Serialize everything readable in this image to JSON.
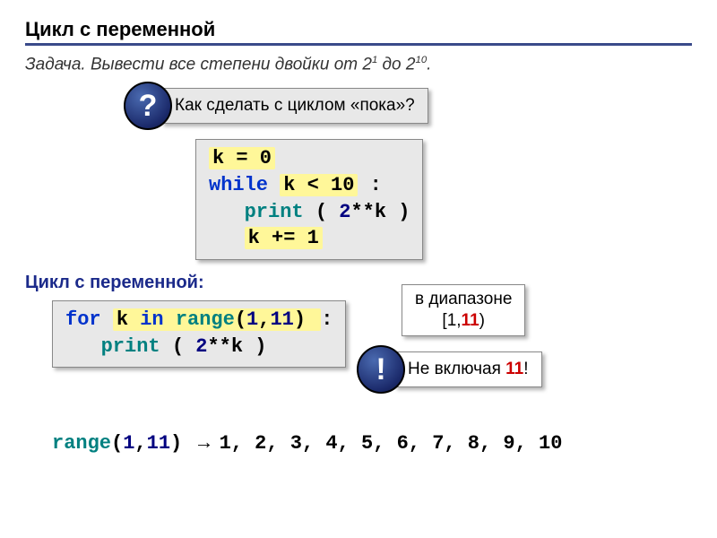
{
  "title": "Цикл с переменной",
  "task_prefix": "Задача.",
  "task_body_a": " Вывести все степени двойки от 2",
  "task_exp1": "1",
  "task_mid": " до 2",
  "task_exp2": "10",
  "task_end": ".",
  "q_badge": "?",
  "q_text": " Как сделать с циклом «пока»?",
  "code1": {
    "l1a": "k = 0",
    "l2a": "while",
    "l2b": "k < 10",
    "l2c": ":",
    "l3a": "print",
    "l3b": "(",
    "l3c": "2",
    "l3d": "**k",
    "l3e": ")",
    "l4a": "k += 1"
  },
  "subtitle": "Цикл с переменной:",
  "code2": {
    "l1a": "for",
    "l1b": "k",
    "l1c": "in",
    "l1d": "range",
    "l1e": "(",
    "l1f": "1",
    "l1g": ",",
    "l1h": "11",
    "l1i": ")",
    "l1j": ":",
    "l2a": "print",
    "l2b": "(",
    "l2c": "2",
    "l2d": "**k",
    "l2e": ")"
  },
  "range_callout_a": "в диапазоне",
  "range_callout_b": "[1,",
  "range_callout_c": "11",
  "range_callout_d": ")",
  "excl_badge": "!",
  "excl_text_a": " Не включая ",
  "excl_text_b": "11",
  "excl_text_c": "!",
  "rangeline": {
    "a": "range",
    "b": "(",
    "c": "1",
    "d": ",",
    "e": "11",
    "f": ")",
    "arrow": " → ",
    "nums": "1, 2, 3, 4, 5, 6, 7, 8, 9, 10"
  }
}
